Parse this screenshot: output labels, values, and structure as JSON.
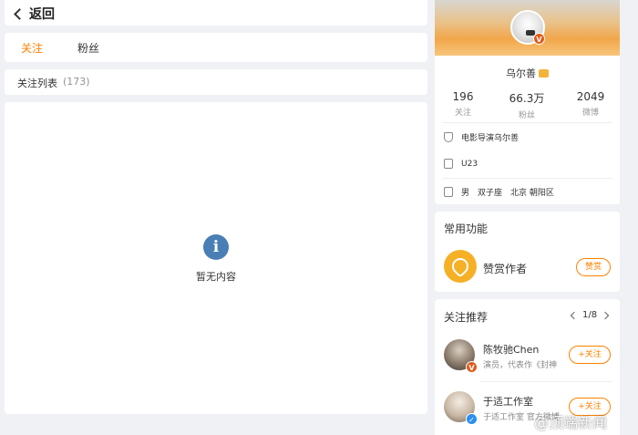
{
  "nav": {
    "back_label": "返回"
  },
  "tabs": [
    {
      "label": "关注"
    },
    {
      "label": "粉丝"
    }
  ],
  "list_header": {
    "label": "关注列表",
    "count": "(173)"
  },
  "empty_state": {
    "icon": "info-icon",
    "text": "暂无内容"
  },
  "profile": {
    "name": "乌尔善",
    "verified_badge": "V",
    "stats": [
      {
        "value": "196",
        "label": "关注"
      },
      {
        "value": "66.3万",
        "label": "粉丝"
      },
      {
        "value": "2049",
        "label": "微博"
      }
    ],
    "info": {
      "title": "电影导演乌尔善",
      "tag": "U23",
      "gender": "男",
      "zodiac": "双子座",
      "location": "北京 朝阳区"
    }
  },
  "common_functions": {
    "title": "常用功能",
    "item_label": "赞赏作者",
    "button_label": "赞赏"
  },
  "recommendations": {
    "title": "关注推荐",
    "page": "1/8",
    "items": [
      {
        "name": "陈牧驰Chen",
        "desc": "演员，代表作《封神",
        "follow_label": "+关注",
        "badge": "V"
      },
      {
        "name": "于适工作室",
        "desc": "于适工作室 官方微博",
        "follow_label": "+关注",
        "badge": "✓"
      }
    ]
  },
  "watermark": "@顶端新闻",
  "colors": {
    "accent": "#ff8200",
    "info_icon": "#4a7fb5",
    "gold": "#f5b026"
  }
}
